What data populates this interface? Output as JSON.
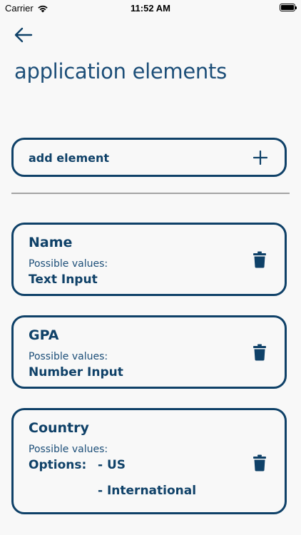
{
  "status_bar": {
    "carrier": "Carrier",
    "time": "11:52 AM"
  },
  "header": {
    "title": "application elements"
  },
  "add_element": {
    "label": "add element"
  },
  "elements": [
    {
      "name": "Name",
      "possible_values_label": "Possible values:",
      "value": "Text Input"
    },
    {
      "name": "GPA",
      "possible_values_label": "Possible values:",
      "value": "Number Input"
    },
    {
      "name": "Country",
      "possible_values_label": "Possible values:",
      "options_label": "Options:",
      "options": [
        "- US",
        "- International"
      ]
    }
  ],
  "colors": {
    "primary": "#0f4168",
    "background": "#f8f8f8",
    "divider": "#a4a4a4"
  }
}
